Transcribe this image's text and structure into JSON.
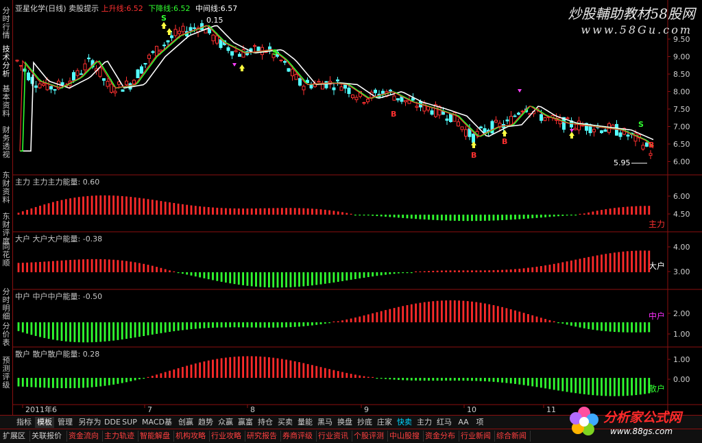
{
  "header": {
    "stock": "亚星化学(日线)",
    "indicator": "卖股提示",
    "up_label": "上升线:",
    "up_value": "6.52",
    "down_label": "下降线:",
    "down_value": "6.52",
    "mid_label": "中间线:",
    "mid_value": "6.57"
  },
  "watermark": {
    "line1": "炒股輔助教材58股网",
    "line2": "www.58Gu.com"
  },
  "sidebar": [
    {
      "label": "分时行情"
    },
    {
      "label": "技术分析"
    },
    {
      "label": "基本资料"
    },
    {
      "label": "财务透视"
    },
    {
      "label": "东财资料"
    },
    {
      "label": "东财评度"
    },
    {
      "label": "同花顺"
    },
    {
      "label": "分时明细"
    },
    {
      "label": "分价表"
    },
    {
      "label": "预测评级"
    }
  ],
  "main_chart": {
    "price_axis": [
      "9.50",
      "9.00",
      "8.50",
      "8.00",
      "7.50",
      "7.00",
      "6.50",
      "6.00"
    ],
    "high_annotation": "0.15",
    "low_annotation": "5.95",
    "buy_marker": "B",
    "sell_marker": "S"
  },
  "panels": [
    {
      "name": "主力",
      "label": "主力能量:",
      "value": "0.60",
      "right_label": "主力",
      "axis": [
        "6.00",
        "4.50"
      ],
      "color": "#ff3030"
    },
    {
      "name": "大户",
      "label": "大户能量:",
      "value": "-0.38",
      "right_label": "大户",
      "axis": [
        "4.00",
        "3.00"
      ],
      "color": "#ffffff"
    },
    {
      "name": "中户",
      "label": "中户能量:",
      "value": "-0.50",
      "right_label": "中户",
      "axis": [
        "2.00",
        "1.00"
      ],
      "color": "#ff30ff"
    },
    {
      "name": "散户",
      "label": "散户能量:",
      "value": "0.28",
      "right_label": "散户",
      "axis": [
        "1.00",
        "0.00"
      ],
      "color": "#30ff30"
    }
  ],
  "date_axis": [
    "2011年6",
    "7",
    "8",
    "9",
    "10",
    "11"
  ],
  "tabs": [
    "指标",
    "模板",
    "管理",
    "另存为",
    "DDE",
    "SUP",
    "MACD基本",
    "创赢",
    "趋势",
    "众赢",
    "赢富",
    "持仓",
    "买卖",
    "量能",
    "黑马",
    "换盘",
    "抄底",
    "庄家",
    "快卖",
    "主力",
    "红马",
    "AA",
    "项"
  ],
  "active_tab": "模板",
  "bottom_bar": [
    "扩展区",
    "关联报价",
    "资金流向",
    "主力轨迹",
    "智能解盘",
    "机构攻略",
    "行业攻略",
    "研究报告",
    "券商评级",
    "行业资讯",
    "个股评测",
    "中山股搜",
    "资金分布",
    "行业新闻",
    "综合新闻"
  ],
  "logo": {
    "text": "分析家公式网",
    "url": "www.88gs.com"
  }
}
